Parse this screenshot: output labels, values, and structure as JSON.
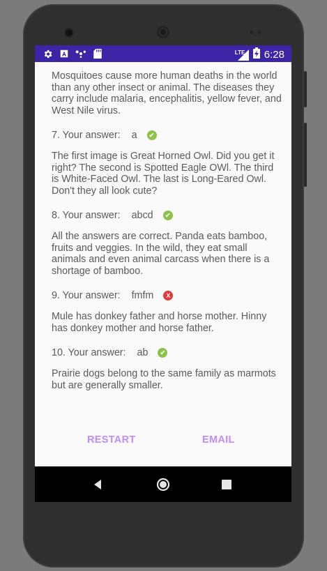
{
  "status_bar": {
    "icons_left": [
      "settings-icon",
      "accessibility-icon",
      "cast-icon",
      "sd-card-icon"
    ],
    "lte_label": "LTE",
    "time": "6:28"
  },
  "results": [
    {
      "type": "paragraph",
      "text": "Mosquitoes cause more human deaths in the world than any other insect or animal. The diseases they carry include malaria, encephalitis, yellow fever, and West Nile virus."
    },
    {
      "type": "answer",
      "label": "7. Your answer:",
      "value": "a",
      "correct": true
    },
    {
      "type": "paragraph",
      "text": "The first image is Great Horned Owl. Did you get it right? The second is Spotted Eagle OWl. The third is White-Faced Owl. The last is Long-Eared Owl. Don't they all look cute?"
    },
    {
      "type": "answer",
      "label": "8. Your answer:",
      "value": "abcd",
      "correct": true
    },
    {
      "type": "paragraph",
      "text": "All the answers are correct. Panda eats bamboo, fruits and veggies. In the wild, they eat small animals and even animal carcass when there is a shortage of bamboo."
    },
    {
      "type": "answer",
      "label": "9. Your answer:",
      "value": "fmfm",
      "correct": false
    },
    {
      "type": "paragraph",
      "text": "Mule has donkey father and horse mother. Hinny has donkey mother and horse father."
    },
    {
      "type": "answer",
      "label": "10. Your answer:",
      "value": "ab",
      "correct": true
    },
    {
      "type": "paragraph",
      "text": "Prairie dogs belong to the same family as marmots but are generally smaller."
    }
  ],
  "buttons": {
    "restart": "RESTART",
    "email": "EMAIL"
  },
  "colors": {
    "status_bar": "#3b24a6",
    "button_text": "#c18bff",
    "correct": "#8bc34a",
    "incorrect": "#e53935"
  },
  "nav": [
    "back-icon",
    "home-icon",
    "recents-icon"
  ]
}
